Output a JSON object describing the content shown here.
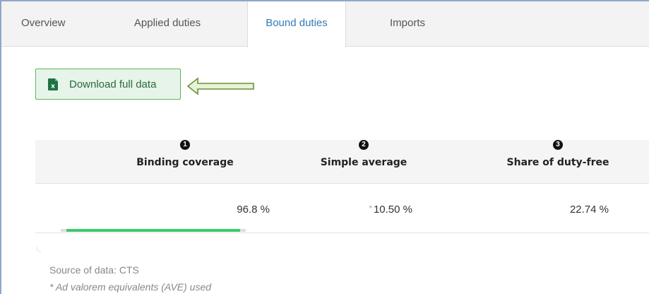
{
  "tabs": [
    {
      "label": "Overview",
      "active": false
    },
    {
      "label": "Applied duties",
      "active": false
    },
    {
      "label": "Bound duties",
      "active": true
    },
    {
      "label": "Imports",
      "active": false
    }
  ],
  "download": {
    "label": "Download full data",
    "icon": "excel-icon",
    "icon_letter": "x",
    "annotation": "arrow-left-icon"
  },
  "stats": [
    {
      "number": "1",
      "label": "Binding coverage",
      "value": "96.8 %",
      "star": "",
      "progress_percent": 96.8
    },
    {
      "number": "2",
      "label": "Simple average",
      "value": "10.50 %",
      "star": "*"
    },
    {
      "number": "3",
      "label": "Share of duty-free",
      "value": "22.74 %",
      "star": ""
    }
  ],
  "footer": {
    "source": "Source of data: CTS",
    "note": "* Ad valorem equivalents (AVE) used"
  },
  "colors": {
    "accent_green": "#3ec96a",
    "button_border": "#5cb85c",
    "button_bg": "#e6f4ea",
    "frame_border": "#8fa7c9",
    "arrow_fill": "#e8f3d6",
    "arrow_stroke": "#6b8e3a",
    "excel_green": "#1f7244"
  }
}
